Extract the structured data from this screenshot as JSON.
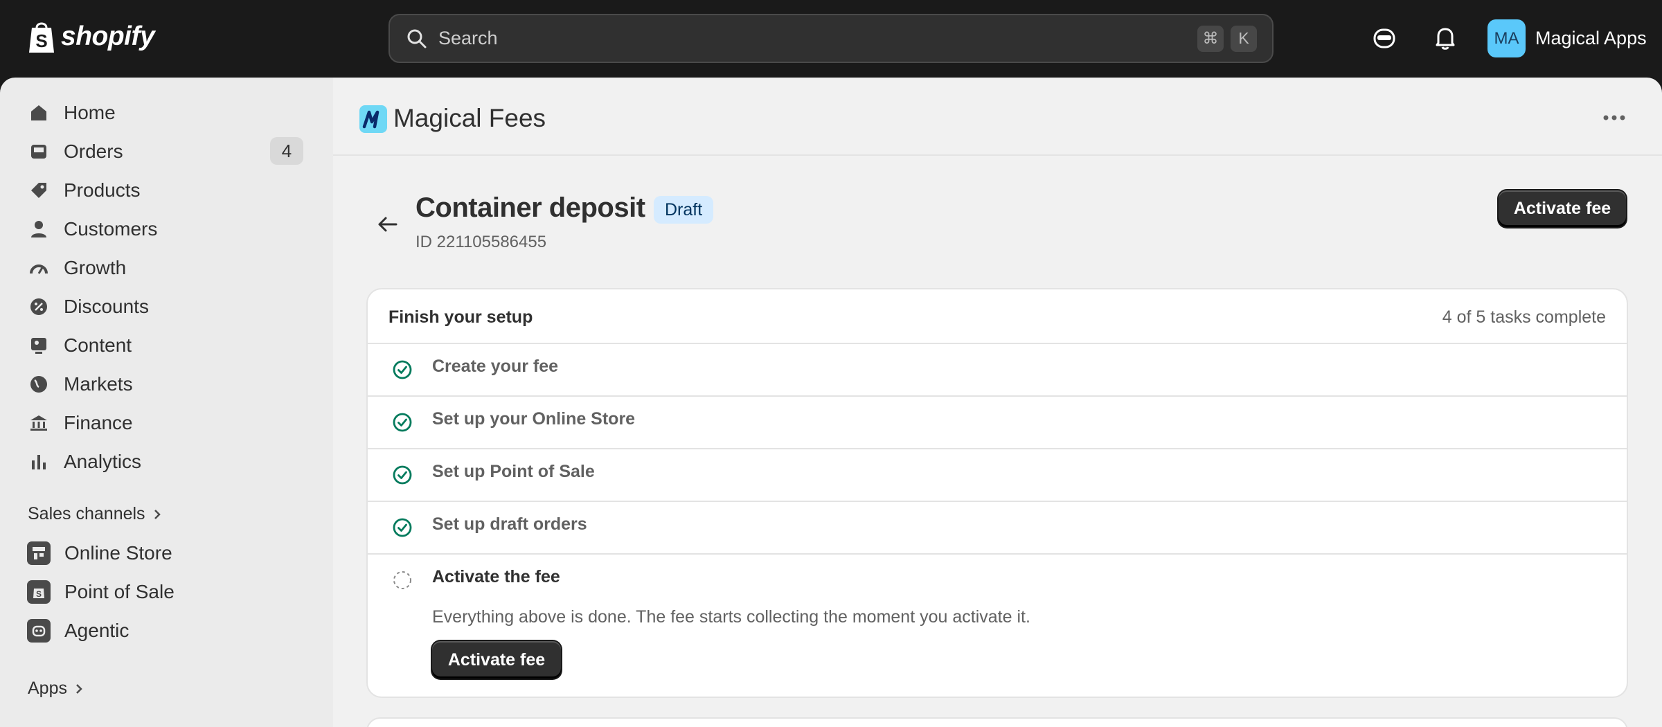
{
  "topbar": {
    "brand": "shopify",
    "search_placeholder": "Search",
    "shortcut_cmd": "⌘",
    "shortcut_key": "K",
    "account_initials": "MA",
    "account_name": "Magical Apps"
  },
  "sidebar": {
    "items": [
      {
        "label": "Home",
        "icon": "home-icon"
      },
      {
        "label": "Orders",
        "icon": "inbox-icon",
        "badge": "4"
      },
      {
        "label": "Products",
        "icon": "tag-icon"
      },
      {
        "label": "Customers",
        "icon": "person-icon"
      },
      {
        "label": "Growth",
        "icon": "gauge-icon"
      },
      {
        "label": "Discounts",
        "icon": "discount-icon"
      },
      {
        "label": "Content",
        "icon": "image-icon"
      },
      {
        "label": "Markets",
        "icon": "globe-icon"
      },
      {
        "label": "Finance",
        "icon": "bank-icon"
      },
      {
        "label": "Analytics",
        "icon": "bar-chart-icon"
      }
    ],
    "sales_channels_label": "Sales channels",
    "channels": [
      {
        "label": "Online Store",
        "icon": "store-icon"
      },
      {
        "label": "Point of Sale",
        "icon": "pos-icon"
      },
      {
        "label": "Agentic",
        "icon": "robot-icon"
      }
    ],
    "apps_label": "Apps"
  },
  "app": {
    "title": "Magical Fees"
  },
  "page": {
    "title": "Container deposit",
    "status": "Draft",
    "fee_id": "ID 221105586455",
    "primary_action": "Activate fee"
  },
  "setup": {
    "title": "Finish your setup",
    "progress_text": "4 of 5 tasks complete",
    "tasks_completed": 4,
    "tasks_total": 5,
    "tasks": [
      {
        "label": "Create your fee",
        "done": true
      },
      {
        "label": "Set up your Online Store",
        "done": true
      },
      {
        "label": "Set up Point of Sale",
        "done": true
      },
      {
        "label": "Set up draft orders",
        "done": true
      },
      {
        "label": "Activate the fee",
        "done": false
      }
    ],
    "active_description": "Everything above is done. The fee starts collecting the moment you activate it.",
    "active_button": "Activate fee"
  },
  "colors": {
    "check_green": "#047b5d",
    "badge_bg": "#d5ebff",
    "avatar_bg": "#5ac8fa"
  }
}
